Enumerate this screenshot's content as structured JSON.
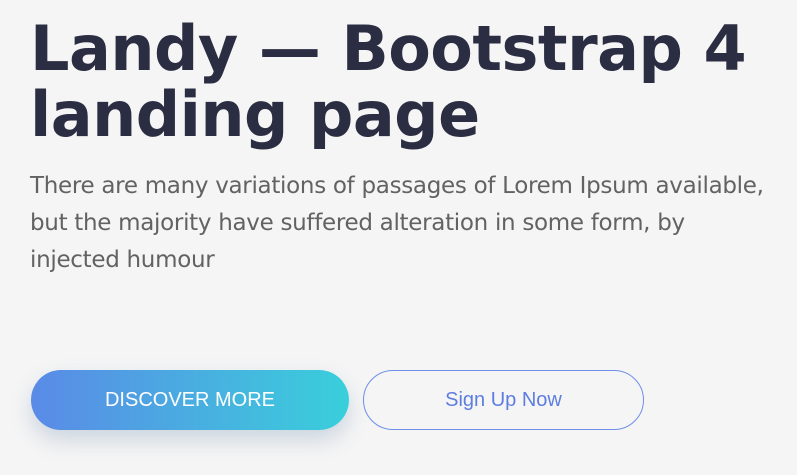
{
  "hero": {
    "title": "Landy — Bootstrap 4 landing page",
    "text": "There are many variations of passages of Lorem Ipsum available, but the majority have suffered alteration in some form, by injected humour"
  },
  "buttons": {
    "primary_label": "DISCOVER MORE",
    "secondary_label": "Sign Up Now"
  },
  "colors": {
    "background": "#f5f5f5",
    "title": "#2b2d42",
    "text": "#626262",
    "gradient_start": "#5a8ae6",
    "gradient_end": "#39cfdb",
    "secondary_border": "#6f8ee8"
  }
}
